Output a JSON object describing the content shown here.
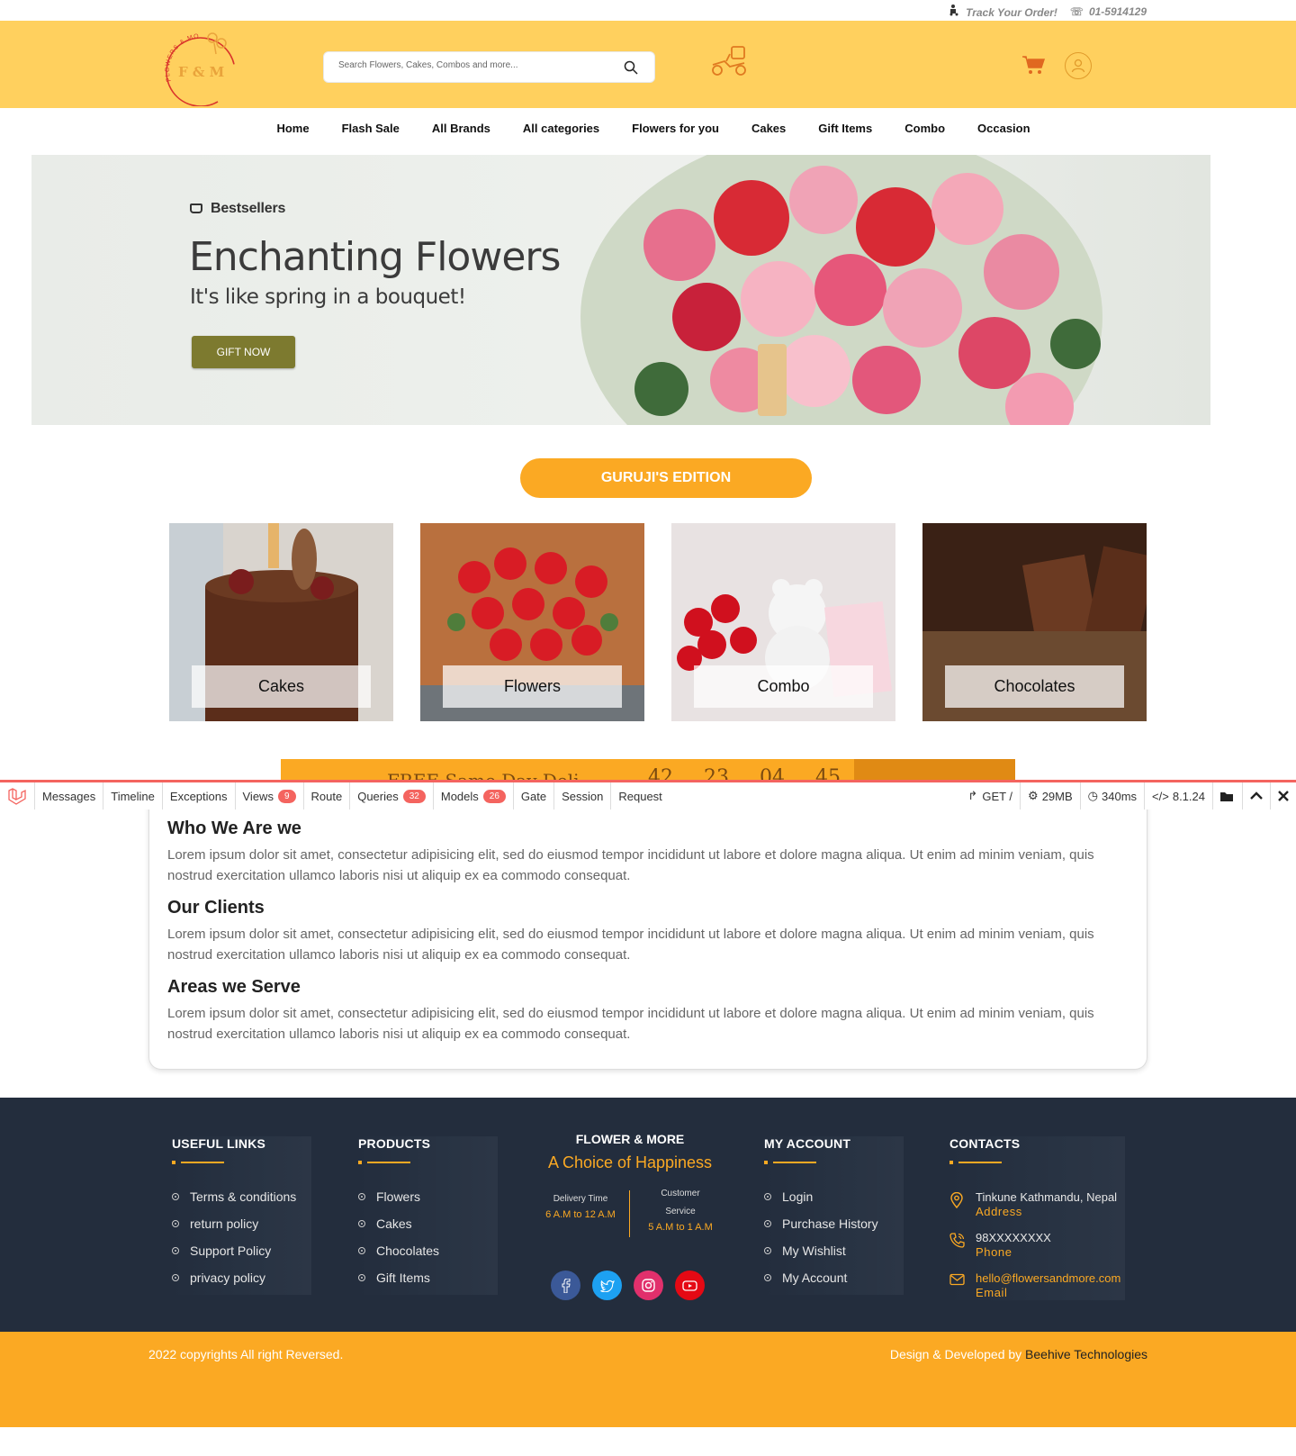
{
  "topbar": {
    "track_label": "Track Your Order!",
    "phone": "01-5914129"
  },
  "header": {
    "logo_text": "F & M",
    "logo_arc_text": "FLOWERS & MORE",
    "search_placeholder": "Search Flowers, Cakes, Combos and more..."
  },
  "nav": {
    "items": [
      "Home",
      "Flash Sale",
      "All Brands",
      "All categories",
      "Flowers for you",
      "Cakes",
      "Gift Items",
      "Combo",
      "Occasion"
    ]
  },
  "banner": {
    "tag": "Bestsellers",
    "title": "Enchanting Flowers",
    "subtitle": "It's like spring in a bouquet!",
    "cta": "GIFT NOW"
  },
  "edition": {
    "label": "GURUJI'S EDITION"
  },
  "categories": [
    {
      "label": "Cakes"
    },
    {
      "label": "Flowers"
    },
    {
      "label": "Combo"
    },
    {
      "label": "Chocolates"
    }
  ],
  "countdown": {
    "text": "FREE Same Day Deli",
    "values": [
      "42",
      "23",
      "04",
      "45"
    ]
  },
  "debugbar": {
    "tabs": [
      "Messages",
      "Timeline",
      "Exceptions",
      "Views",
      "Route",
      "Queries",
      "Models",
      "Gate",
      "Session",
      "Request"
    ],
    "views_count": "9",
    "queries_count": "32",
    "models_count": "26",
    "method": "GET /",
    "memory": "29MB",
    "time": "340ms",
    "version": "8.1.24"
  },
  "about": {
    "sections": [
      {
        "title": "Who We Are we",
        "text": "Lorem ipsum dolor sit amet, consectetur adipisicing elit, sed do eiusmod tempor incididunt ut labore et dolore magna aliqua. Ut enim ad minim veniam, quis nostrud exercitation ullamco laboris nisi ut aliquip ex ea commodo consequat."
      },
      {
        "title": "Our Clients",
        "text": "Lorem ipsum dolor sit amet, consectetur adipisicing elit, sed do eiusmod tempor incididunt ut labore et dolore magna aliqua. Ut enim ad minim veniam, quis nostrud exercitation ullamco laboris nisi ut aliquip ex ea commodo consequat."
      },
      {
        "title": "Areas we Serve",
        "text": "Lorem ipsum dolor sit amet, consectetur adipisicing elit, sed do eiusmod tempor incididunt ut labore et dolore magna aliqua. Ut enim ad minim veniam, quis nostrud exercitation ullamco laboris nisi ut aliquip ex ea commodo consequat."
      }
    ]
  },
  "footer": {
    "useful_links": {
      "title": "USEFUL LINKS",
      "items": [
        "Terms & conditions",
        "return policy",
        "Support Policy",
        "privacy policy"
      ]
    },
    "products": {
      "title": "PRODUCTS",
      "items": [
        "Flowers",
        "Cakes",
        "Chocolates",
        "Gift Items"
      ]
    },
    "brand": {
      "name": "FLOWER & MORE",
      "tagline": "A Choice of Happiness",
      "delivery_label": "Delivery Time",
      "delivery_value": "6 A.M to 12 A.M",
      "service_label": "Customer Service",
      "service_value": "5 A.M to 1 A.M"
    },
    "my_account": {
      "title": "MY ACCOUNT",
      "items": [
        "Login",
        "Purchase History",
        "My Wishlist",
        "My Account"
      ]
    },
    "contacts": {
      "title": "CONTACTS",
      "address": "Tinkune Kathmandu, Nepal",
      "address_label": "Address",
      "phone": "98XXXXXXXX",
      "phone_label": "Phone",
      "email": "hello@flowersandmore.com",
      "email_label": "Email"
    }
  },
  "copyright": {
    "left": "2022 copyrights All right Reversed.",
    "right_prefix": "Design & Developed by",
    "right_link": "Beehive Technologies"
  },
  "colors": {
    "header_bg": "#ffd05e",
    "accent": "#fba923",
    "footer_bg": "#232d3d",
    "debug_red": "#f4645f"
  }
}
